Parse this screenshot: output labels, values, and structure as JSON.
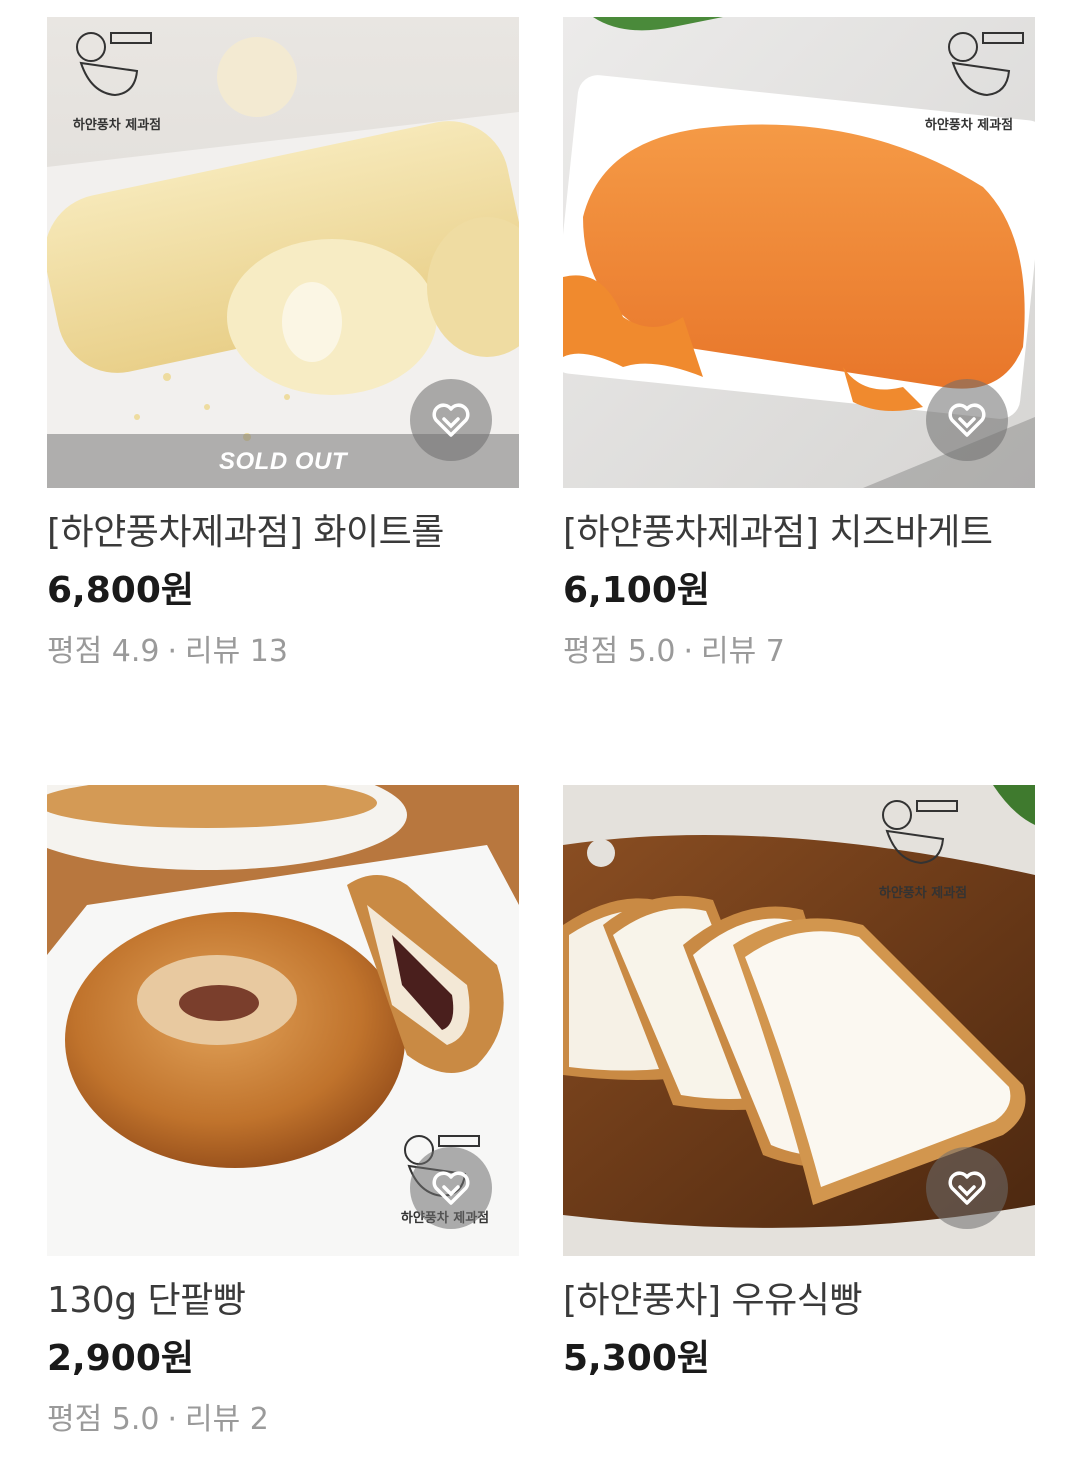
{
  "products": [
    {
      "name": "[하얀풍차제과점] 화이트롤",
      "price": "6,800원",
      "rating_label": "평점 4.9",
      "review_label": "리뷰 13",
      "badge": "SOLD OUT",
      "logo_text": "하얀풍차 제과점",
      "image": "white-roll-photo"
    },
    {
      "name": "[하얀풍차제과점] 치즈바게트",
      "price": "6,100원",
      "rating_label": "평점 5.0",
      "review_label": "리뷰 7",
      "logo_text": "하얀풍차 제과점",
      "image": "cheese-baguette-photo"
    },
    {
      "name": "130g 단팥빵",
      "price": "2,900원",
      "rating_label": "평점 5.0",
      "review_label": "리뷰 2",
      "logo_text": "하얀풍차 제과점",
      "image": "red-bean-bun-photo"
    },
    {
      "name": "[하얀풍차] 우유식빵",
      "price": "5,300원",
      "logo_text": "하얀풍차 제과점",
      "image": "milk-bread-photo"
    }
  ],
  "meta_separator": "·",
  "colors": {
    "price": "#1a1a1a",
    "name": "#3a3a3a",
    "meta": "#9a9a9a",
    "wish_bg": "#6e6e6e"
  }
}
